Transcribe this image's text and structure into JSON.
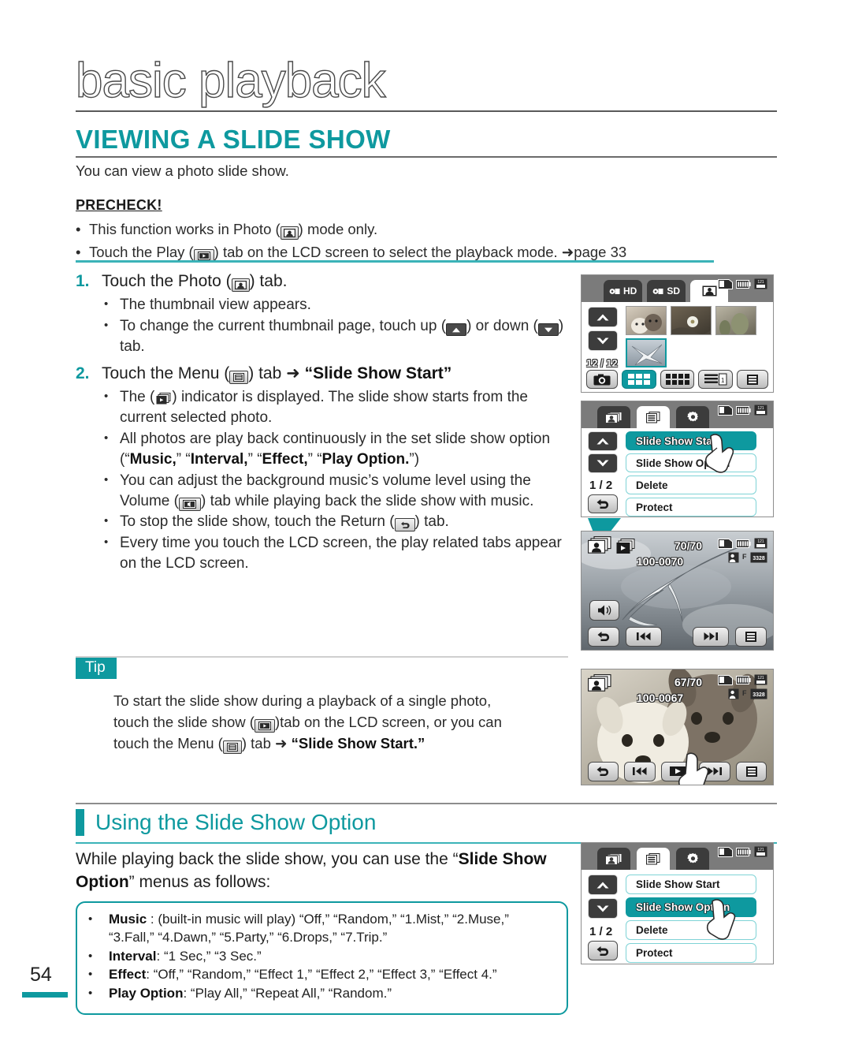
{
  "masthead": {
    "title": "basic playback"
  },
  "section": {
    "title": "VIEWING A SLIDE SHOW",
    "intro": "You can view a photo slide show."
  },
  "precheck": {
    "title": "PRECHECK!",
    "items": [
      {
        "pre": "This function works in Photo (",
        "icon": "photo-icon",
        "post": ") mode only."
      },
      {
        "pre": "Touch the Play (",
        "icon": "play-icon",
        "post": ") tab on the LCD screen to select the playback mode. ➜page 33"
      }
    ]
  },
  "steps": [
    {
      "num": "1.",
      "text_pre": "Touch the Photo (",
      "icon": "photo-icon",
      "text_post": ") tab.",
      "subs": [
        "The thumbnail view appears.",
        "To change the current thumbnail page, touch up (▲) or down (▼) tab."
      ]
    },
    {
      "num": "2.",
      "text_pre": "Touch the Menu (",
      "icon": "menu-icon",
      "text_post": ") tab ➜ “Slide Show Start”",
      "subs": [
        "The (▶) indicator is displayed. The slide show starts from the current selected photo.",
        "All photos are play back continuously in the set slide show option (“Music,” “Interval,” “Effect,” “Play Option.”)",
        "You can adjust the background music’s volume level using the Volume (◀) tab while playing back the slide show with music.",
        "To stop the slide show, touch the Return (↩) tab.",
        "Every time you touch the LCD screen, the play related tabs appear on the LCD screen."
      ]
    }
  ],
  "step_text": {
    "s1_line1": "The thumbnail view appears.",
    "s1_line2a": "To change the current thumbnail page, touch up (",
    "s1_line2b": ") or down (",
    "s1_line2c": ") tab.",
    "s2_b1a": "The (",
    "s2_b1b": ") indicator is displayed. The slide show starts from the current selected photo.",
    "s2_b2a": "All photos are play back continuously in the set slide show option (“",
    "s2_music": "Music,",
    "s2_interval": "Interval,",
    "s2_effect": "Effect,",
    "s2_playoption": "Play Option.",
    "s2_b3a": "You can adjust the background music’s volume level using the Volume (",
    "s2_b3b": ") tab while playing back the slide show with music.",
    "s2_b4a": "To stop the slide show, touch the Return (",
    "s2_b4b": ") tab.",
    "s2_b5": "Every time you touch the LCD screen, the play related tabs appear on the LCD screen.",
    "slide_show_start_quoted": "“Slide Show Start”",
    "touch_photo_pre": "Touch the Photo (",
    "touch_photo_post": ") tab.",
    "touch_menu_pre": "Touch the Menu (",
    "touch_menu_post": ") tab",
    "arrow": "➜"
  },
  "tip": {
    "badge": "Tip",
    "line1": "To start the slide show during a playback of a single photo,",
    "line2a": "touch the slide show (",
    "line2b": ")tab on the LCD screen, or you can",
    "line3a": "touch the Menu (",
    "line3b": ") tab",
    "line3c": "➜",
    "line3_bold": "“Slide Show Start.”"
  },
  "subsection": {
    "title": "Using the Slide Show Option",
    "intro_a": "While playing back the slide show, you can use the “",
    "intro_bold1": "Slide Show Option",
    "intro_b": "” menus as follows:"
  },
  "options": [
    {
      "label": "Music",
      "sep": " : ",
      "value": "(built-in music will play) “Off,” “Random,” “1.Mist,” “2.Muse,” “3.Fall,” “4.Dawn,” “5.Party,” “6.Drops,” “7.Trip.”"
    },
    {
      "label": "Interval",
      "sep": ": ",
      "value": "“1 Sec,” “3 Sec.”"
    },
    {
      "label": "Effect",
      "sep": ": ",
      "value": "“Off,” “Random,” “Effect 1,” “Effect 2,” “Effect 3,” “Effect 4.”"
    },
    {
      "label": "Play Option",
      "sep": ": ",
      "value": "“Play All,” “Repeat All,” “Random.”"
    }
  ],
  "page_number": "54",
  "lcd": {
    "thumbnail_view": {
      "tabs": [
        {
          "label": "HD",
          "active": false
        },
        {
          "label": "SD",
          "active": false
        },
        {
          "label": "",
          "active": true,
          "icon": "photo-tab-icon"
        }
      ],
      "counter": "12 / 12",
      "up_label": "▲",
      "down_label": "▼",
      "toolbar": [
        "camera-icon",
        "grid-6-icon",
        "grid-12-icon",
        "date-list-icon",
        "menu-icon"
      ],
      "selected_toolbar_index": 1
    },
    "menu_screen_1": {
      "tabs": [
        "photo-tab-icon",
        "menu-tab-icon",
        "settings-tab-icon"
      ],
      "active_tab_index": 1,
      "items": [
        "Slide Show Start",
        "Slide Show Option",
        "Delete",
        "Protect"
      ],
      "selected_index": 0,
      "page_indicator": "1 / 2",
      "return_label": "↩"
    },
    "slideshow_play": {
      "counter": "70/70",
      "file_id": "100-0070",
      "buttons": [
        "return-icon",
        "prev-icon",
        "next-icon",
        "menu-icon"
      ],
      "volume_icon": "volume-icon",
      "slideshow_indicator": "slideshow-icon"
    },
    "single_photo": {
      "counter": "67/70",
      "file_id": "100-0067",
      "buttons": [
        "return-icon",
        "prev-icon",
        "slideshow-icon",
        "next-icon",
        "menu-icon"
      ]
    },
    "menu_screen_2": {
      "tabs": [
        "photo-tab-icon",
        "menu-tab-icon",
        "settings-tab-icon"
      ],
      "active_tab_index": 1,
      "items": [
        "Slide Show Start",
        "Slide Show Option",
        "Delete",
        "Protect"
      ],
      "selected_index": 1,
      "page_indicator": "1 / 2",
      "return_label": "↩"
    }
  },
  "colors": {
    "accent": "#0e999f",
    "accent_light": "#3bb3b8",
    "text": "#1f1f1f"
  }
}
